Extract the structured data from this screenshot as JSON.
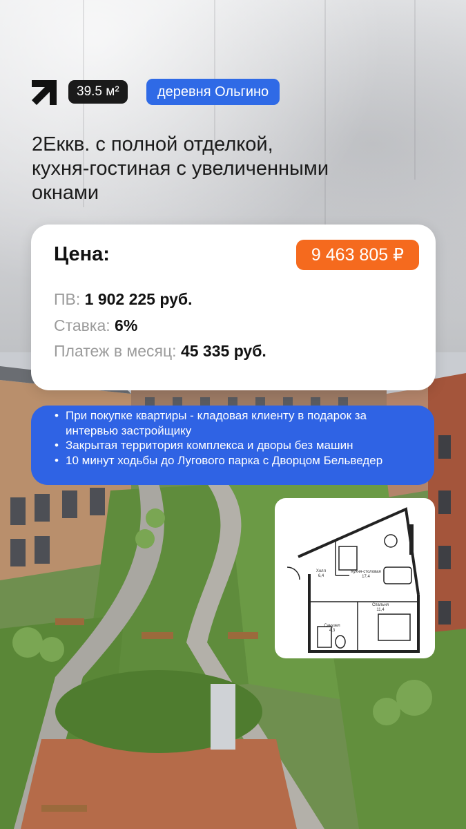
{
  "header": {
    "area_badge": "39.5 м²",
    "location_badge": "деревня Ольгино",
    "headline_lines": [
      "2Еккв. с полной отделкой,",
      "кухня-гостиная с увеличенными",
      "окнами"
    ]
  },
  "price_card": {
    "price_label": "Цена:",
    "price_value": "9 463 805 ₽",
    "down_payment_label": "ПВ:",
    "down_payment_value": "1 902 225 руб.",
    "rate_label": "Ставка:",
    "rate_value": "6%",
    "monthly_label": "Платеж в месяц:",
    "monthly_value": "45 335 руб."
  },
  "features": [
    "При покупке квартиры - кладовая клиенту в подарок за интервью застройщику",
    "Закрытая территория комплекса и дворы без машин",
    "10 минут ходьбы до Лугового парка с Дворцом Бельведер"
  ],
  "floor_plan": {
    "rooms": [
      {
        "name": "Холл",
        "area": "6,4"
      },
      {
        "name": "Кухня-столовая",
        "area": "17,4"
      },
      {
        "name": "Спальня",
        "area": "11,4"
      },
      {
        "name": "Санузел",
        "area": "4,3"
      }
    ]
  },
  "colors": {
    "accent_blue": "#2f63e4",
    "price_orange": "#f56a1e",
    "area_badge_bg": "#1a1a1a"
  },
  "icons": {
    "logo": "arrow-up-right-icon"
  }
}
